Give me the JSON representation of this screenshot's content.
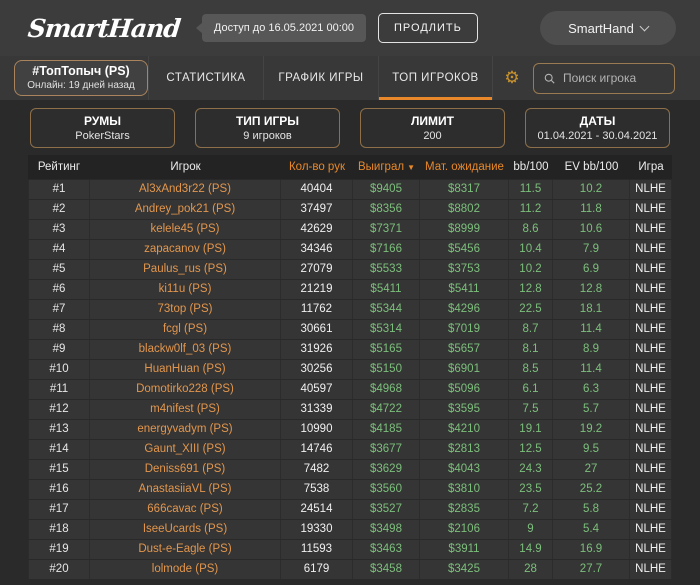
{
  "colors": {
    "accent_orange": "#e8882a",
    "player_orange": "#e2964d",
    "money_green": "#7cbf7c",
    "filter_border_tan": "#8d7049",
    "topbar_bg": "#3c3c3c",
    "row_bg": "#353535"
  },
  "topbar": {
    "logo": "SmartHand",
    "access_badge": "Доступ до 16.05.2021 00:00",
    "renew_button": "ПРОДЛИТЬ",
    "account_menu": "SmartHand"
  },
  "nav": {
    "profile": {
      "name": "#ТопТопыч (PS)",
      "status": "Онлайн: 19 дней назад"
    },
    "tabs": [
      {
        "label": "СТАТИСТИКА",
        "active": false
      },
      {
        "label": "ГРАФИК ИГРЫ",
        "active": false
      },
      {
        "label": "ТОП ИГРОКОВ",
        "active": true
      }
    ],
    "search_placeholder": "Поиск игрока"
  },
  "filters": [
    {
      "label": "РУМЫ",
      "value": "PokerStars"
    },
    {
      "label": "ТИП ИГРЫ",
      "value": "9 игроков"
    },
    {
      "label": "ЛИМИТ",
      "value": "200"
    },
    {
      "label": "ДАТЫ",
      "value": "01.04.2021 - 30.04.2021"
    }
  ],
  "table": {
    "columns": [
      "Рейтинг",
      "Игрок",
      "Кол-во рук",
      "Выиграл",
      "Мат. ожидание",
      "bb/100",
      "EV bb/100",
      "Игра"
    ],
    "sort_column": "Выиграл",
    "sort_direction": "desc",
    "rows": [
      {
        "rank": "#1",
        "player": "Al3xAnd3r22 (PS)",
        "hands": "40404",
        "won": "$9405",
        "ev": "$8317",
        "bb": "11.5",
        "evbb": "10.2",
        "game": "NLHE"
      },
      {
        "rank": "#2",
        "player": "Andrey_pok21 (PS)",
        "hands": "37497",
        "won": "$8356",
        "ev": "$8802",
        "bb": "11.2",
        "evbb": "11.8",
        "game": "NLHE"
      },
      {
        "rank": "#3",
        "player": "kelele45 (PS)",
        "hands": "42629",
        "won": "$7371",
        "ev": "$8999",
        "bb": "8.6",
        "evbb": "10.6",
        "game": "NLHE"
      },
      {
        "rank": "#4",
        "player": "zapacanov (PS)",
        "hands": "34346",
        "won": "$7166",
        "ev": "$5456",
        "bb": "10.4",
        "evbb": "7.9",
        "game": "NLHE"
      },
      {
        "rank": "#5",
        "player": "Paulus_rus (PS)",
        "hands": "27079",
        "won": "$5533",
        "ev": "$3753",
        "bb": "10.2",
        "evbb": "6.9",
        "game": "NLHE"
      },
      {
        "rank": "#6",
        "player": "ki11u (PS)",
        "hands": "21219",
        "won": "$5411",
        "ev": "$5411",
        "bb": "12.8",
        "evbb": "12.8",
        "game": "NLHE"
      },
      {
        "rank": "#7",
        "player": "73top (PS)",
        "hands": "11762",
        "won": "$5344",
        "ev": "$4296",
        "bb": "22.5",
        "evbb": "18.1",
        "game": "NLHE"
      },
      {
        "rank": "#8",
        "player": "fcgl (PS)",
        "hands": "30661",
        "won": "$5314",
        "ev": "$7019",
        "bb": "8.7",
        "evbb": "11.4",
        "game": "NLHE"
      },
      {
        "rank": "#9",
        "player": "blackw0lf_03 (PS)",
        "hands": "31926",
        "won": "$5165",
        "ev": "$5657",
        "bb": "8.1",
        "evbb": "8.9",
        "game": "NLHE"
      },
      {
        "rank": "#10",
        "player": "HuanHuan (PS)",
        "hands": "30256",
        "won": "$5150",
        "ev": "$6901",
        "bb": "8.5",
        "evbb": "11.4",
        "game": "NLHE"
      },
      {
        "rank": "#11",
        "player": "Domotirko228 (PS)",
        "hands": "40597",
        "won": "$4968",
        "ev": "$5096",
        "bb": "6.1",
        "evbb": "6.3",
        "game": "NLHE"
      },
      {
        "rank": "#12",
        "player": "m4nifest (PS)",
        "hands": "31339",
        "won": "$4722",
        "ev": "$3595",
        "bb": "7.5",
        "evbb": "5.7",
        "game": "NLHE"
      },
      {
        "rank": "#13",
        "player": "energyvadym (PS)",
        "hands": "10990",
        "won": "$4185",
        "ev": "$4210",
        "bb": "19.1",
        "evbb": "19.2",
        "game": "NLHE"
      },
      {
        "rank": "#14",
        "player": "Gaunt_XIII (PS)",
        "hands": "14746",
        "won": "$3677",
        "ev": "$2813",
        "bb": "12.5",
        "evbb": "9.5",
        "game": "NLHE"
      },
      {
        "rank": "#15",
        "player": "Deniss691 (PS)",
        "hands": "7482",
        "won": "$3629",
        "ev": "$4043",
        "bb": "24.3",
        "evbb": "27",
        "game": "NLHE"
      },
      {
        "rank": "#16",
        "player": "AnastasiiaVL (PS)",
        "hands": "7538",
        "won": "$3560",
        "ev": "$3810",
        "bb": "23.5",
        "evbb": "25.2",
        "game": "NLHE"
      },
      {
        "rank": "#17",
        "player": "666cavac (PS)",
        "hands": "24514",
        "won": "$3527",
        "ev": "$2835",
        "bb": "7.2",
        "evbb": "5.8",
        "game": "NLHE"
      },
      {
        "rank": "#18",
        "player": "IseeUcards (PS)",
        "hands": "19330",
        "won": "$3498",
        "ev": "$2106",
        "bb": "9",
        "evbb": "5.4",
        "game": "NLHE"
      },
      {
        "rank": "#19",
        "player": "Dust-e-Eagle (PS)",
        "hands": "11593",
        "won": "$3463",
        "ev": "$3911",
        "bb": "14.9",
        "evbb": "16.9",
        "game": "NLHE"
      },
      {
        "rank": "#20",
        "player": "lolmode (PS)",
        "hands": "6179",
        "won": "$3458",
        "ev": "$3425",
        "bb": "28",
        "evbb": "27.7",
        "game": "NLHE"
      }
    ]
  },
  "icons": {
    "gear": "⚙",
    "sort_desc": "▼"
  }
}
